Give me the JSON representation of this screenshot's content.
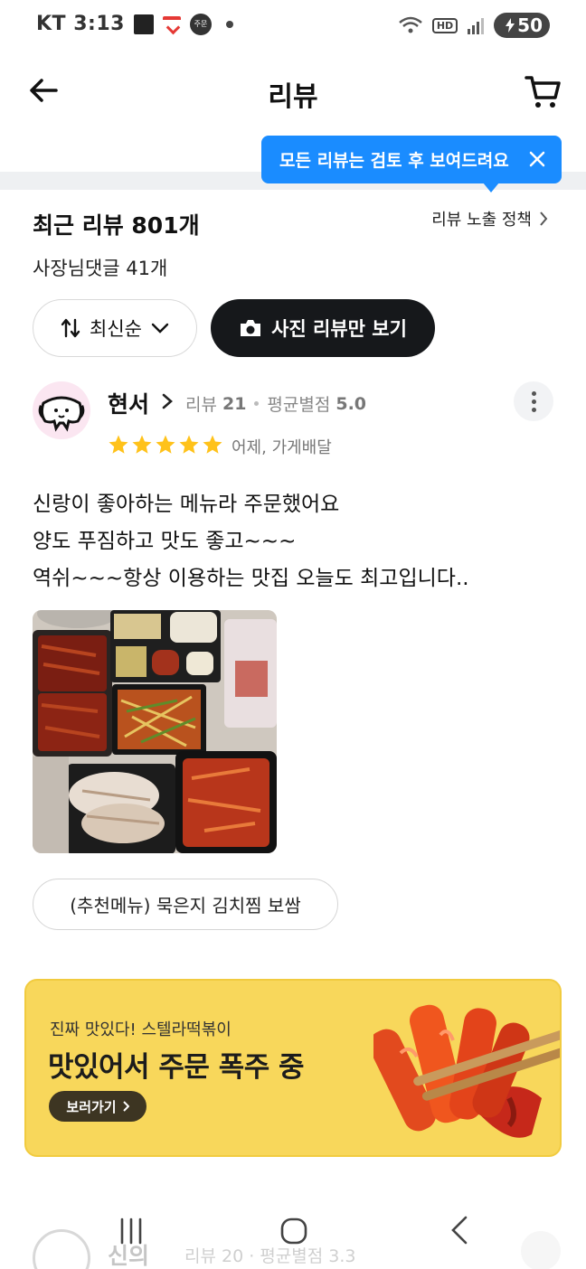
{
  "status_bar": {
    "carrier": "KT",
    "time": "3:13",
    "notification_badge": "주문",
    "hd": "HD",
    "battery": "50"
  },
  "header": {
    "title": "리뷰"
  },
  "tooltip": {
    "text": "모든 리뷰는 검토 후 보여드려요"
  },
  "summary": {
    "review_count": "최근 리뷰 801개",
    "owner_replies": "사장님댓글 41개",
    "policy_link": "리뷰 노출 정책"
  },
  "filters": {
    "sort_label": "최신순",
    "photo_only_label": "사진 리뷰만 보기"
  },
  "review": {
    "author": "현서",
    "review_label": "리뷰",
    "review_count": "21",
    "avg_label": "평균별점",
    "avg_rating": "5.0",
    "rating": 5,
    "meta": "어제, 가게배달",
    "text_lines": [
      "신랑이 좋아하는 메뉴라 주문했어요",
      "양도 푸짐하고 맛도 좋고~~~",
      "역쉬~~~항상 이용하는 맛집 오늘도 최고입니다.."
    ],
    "menu_chip": "(추천메뉴) 묵은지 김치찜 보쌈"
  },
  "ad": {
    "subtitle": "진짜 맛있다! 스텔라떡볶이",
    "title": "맛있어서 주문 폭주 중",
    "button_label": "보러가기"
  },
  "next_review": {
    "author": "신의",
    "stats": "리뷰 20 · 평균별점 3.3"
  },
  "colors": {
    "tooltip_blue": "#1a8cff",
    "star_yellow": "#ffc21a",
    "ad_yellow": "#f8d75b",
    "dark_button": "#16181b"
  }
}
